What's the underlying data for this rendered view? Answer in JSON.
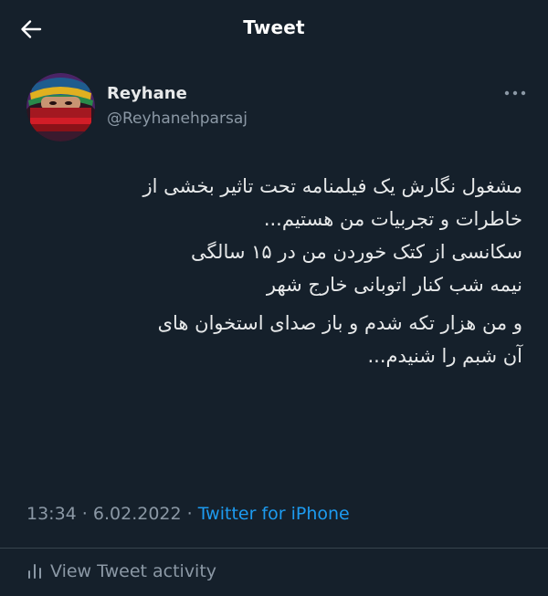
{
  "header": {
    "title": "Tweet",
    "back_icon": "arrow-left-icon"
  },
  "author": {
    "name": "Reyhane",
    "handle": "@Reyhanehparsaj",
    "avatar_icon": "avatar-photo",
    "more_icon": "more-horizontal-icon"
  },
  "tweet": {
    "paragraphs": [
      {
        "lines": [
          "مشغول نگارش یک فیلمنامه تحت تاثیر بخشی از",
          "خاطرات و تجربیات من هستیم...",
          "سکانسی از کتک خوردن من در ۱۵ سالگی",
          "نیمه شب کنار اتوبانی خارج شهر"
        ]
      },
      {
        "lines": [
          "و من هزار تکه شدم و باز صدای استخوان های",
          "آن شبم را شنیدم..."
        ]
      }
    ]
  },
  "meta": {
    "time": "13:34",
    "separator": " · ",
    "date": "6.02.2022",
    "source": "Twitter for iPhone"
  },
  "activity": {
    "label": "View Tweet activity",
    "icon": "bar-chart-icon"
  },
  "colors": {
    "background": "#15202b",
    "text": "#e7e9ea",
    "muted": "#8b98a5",
    "accent": "#1d9bf0",
    "divider": "#38444d"
  }
}
